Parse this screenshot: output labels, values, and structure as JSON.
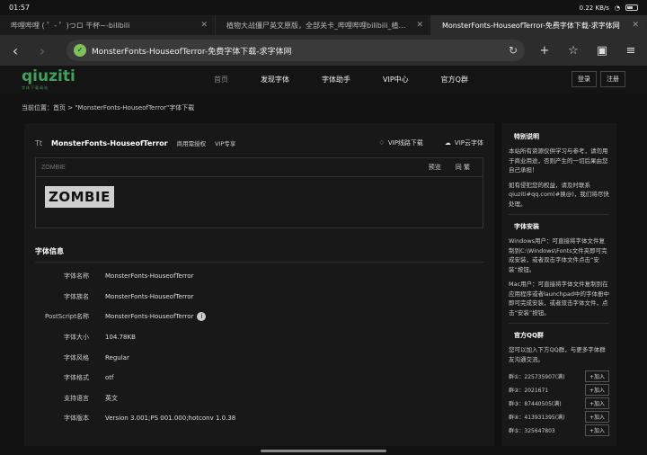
{
  "status": {
    "time": "01:57",
    "net": "0.22 KB/s",
    "battery": "48"
  },
  "tabs": [
    {
      "title": "哔哩哔哩 ( ゜- ゜)つロ 干杯~-bilibili",
      "active": false
    },
    {
      "title": "植物大战僵尸英文原版，全部关卡_哔哩哔哩bilibili_植物大战僵尸",
      "active": false
    },
    {
      "title": "MonsterFonts-HouseofTerror-免费字体下载-求字体网",
      "active": true
    }
  ],
  "toolbar": {
    "url": "MonsterFonts-HouseofTerror-免费字体下载-求字体网",
    "icons": [
      "back-icon",
      "forward-icon",
      "lock-icon",
      "reload-icon",
      "plus-icon",
      "star-icon",
      "extension-icon",
      "menu-icon"
    ]
  },
  "site": {
    "logo": "qiuziti",
    "logo_sub": "字体下载网站",
    "nav": [
      "首页",
      "发现字体",
      "字体助手",
      "VIP中心",
      "官方Q群"
    ],
    "login": "登录",
    "register": "注册"
  },
  "breadcrumb": "当前位置：首页 > \"MonsterFonts-HouseofTerror\"字体下载",
  "font": {
    "name": "MonsterFonts-HouseofTerror",
    "tag1": "商用需授权",
    "tag2": "VIP专享",
    "action_vip_download": "VIP线路下载",
    "action_vip_cloud": "VIP云字体",
    "preview_text": "ZOMBIE",
    "preview_button": "预览",
    "reset_button": "同 繁",
    "sample": "ZOMBIE"
  },
  "info": {
    "title": "字体信息",
    "rows": [
      {
        "k": "字体名称",
        "v": "MonsterFonts-HouseofTerror"
      },
      {
        "k": "字体族名",
        "v": "MonsterFonts-HouseofTerror"
      },
      {
        "k": "PostScript名称",
        "v": "MonsterFonts-HouseofTerror"
      },
      {
        "k": "字体大小",
        "v": "104.78KB"
      },
      {
        "k": "字体风格",
        "v": "Regular"
      },
      {
        "k": "字体格式",
        "v": "otf"
      },
      {
        "k": "支持语言",
        "v": "英文"
      },
      {
        "k": "字体版本",
        "v": "Version 3.001;PS 001.000;hotconv 1.0.38"
      }
    ]
  },
  "sidebar": {
    "notice_title": "特别说明",
    "notice_p1": "本站所有资源仅供学习与参考，请勿用于商业用途，否则产生的一切后果由您自己承担！",
    "notice_p2": "如有侵犯您的权益，请及时联系qiuziti#qq.com(#换@)，我们将尽快处理。",
    "install_title": "字体安装",
    "install_win": "Windows用户：可直接将字体文件复制到C:\\Windows\\Fonts文件夹即可完成安装，或者双击字体文件点击“安装”按钮。",
    "install_mac": "Mac用户：可直接将字体文件复制到在应用程序或者launchpad中的字体册中即可完成安装，或者双击字体文件，点击“安装”按钮。",
    "qq_title": "官方QQ群",
    "qq_desc": "您可以加入下方QQ群，与更多字体群友沟通交流。",
    "join_label": "+加入",
    "groups": [
      "群①：225735907(满)",
      "群②：2021671",
      "群③：87440505(满)",
      "群④：413931395(满)",
      "群⑤：325647803"
    ]
  }
}
